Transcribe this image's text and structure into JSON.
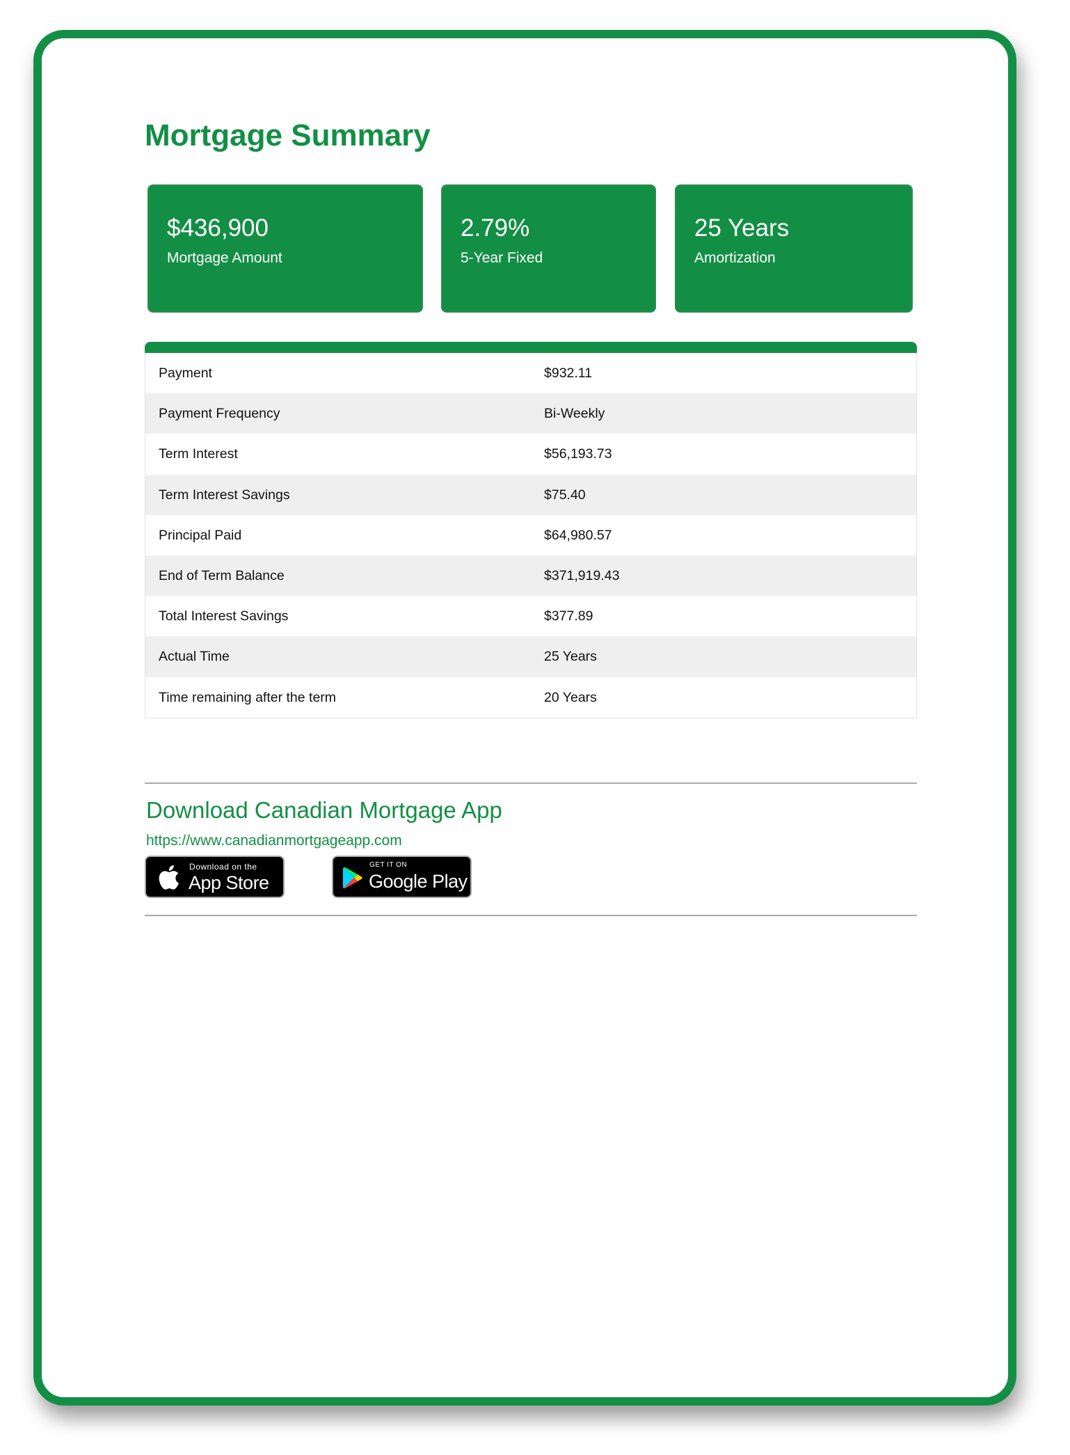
{
  "summary": {
    "title": "Mortgage Summary",
    "cards": [
      {
        "value": "$436,900",
        "label": "Mortgage Amount"
      },
      {
        "value": "2.79%",
        "label": "5-Year Fixed"
      },
      {
        "value": "25 Years",
        "label": "Amortization"
      }
    ]
  },
  "details": {
    "rows": [
      {
        "label": "Payment",
        "value": "$932.11"
      },
      {
        "label": "Payment Frequency",
        "value": "Bi-Weekly"
      },
      {
        "label": "Term Interest",
        "value": "$56,193.73"
      },
      {
        "label": "Term Interest Savings",
        "value": "$75.40"
      },
      {
        "label": "Principal Paid",
        "value": "$64,980.57"
      },
      {
        "label": "End of Term Balance",
        "value": "$371,919.43"
      },
      {
        "label": "Total Interest Savings",
        "value": "$377.89"
      },
      {
        "label": "Actual Time",
        "value": "25 Years"
      },
      {
        "label": "Time remaining after the term",
        "value": "20 Years"
      }
    ]
  },
  "app": {
    "heading": "Download Canadian Mortgage App",
    "link": "https://www.canadianmortgageapp.com",
    "app_store": {
      "small": "Download on the",
      "big": "App Store",
      "icon": "apple-icon"
    },
    "google_play": {
      "small": "GET IT ON",
      "big": "Google Play",
      "icon": "google-play-icon"
    }
  },
  "colors": {
    "brand": "#138f45",
    "row_alt": "#efefef",
    "divider": "#a9a9a9"
  }
}
